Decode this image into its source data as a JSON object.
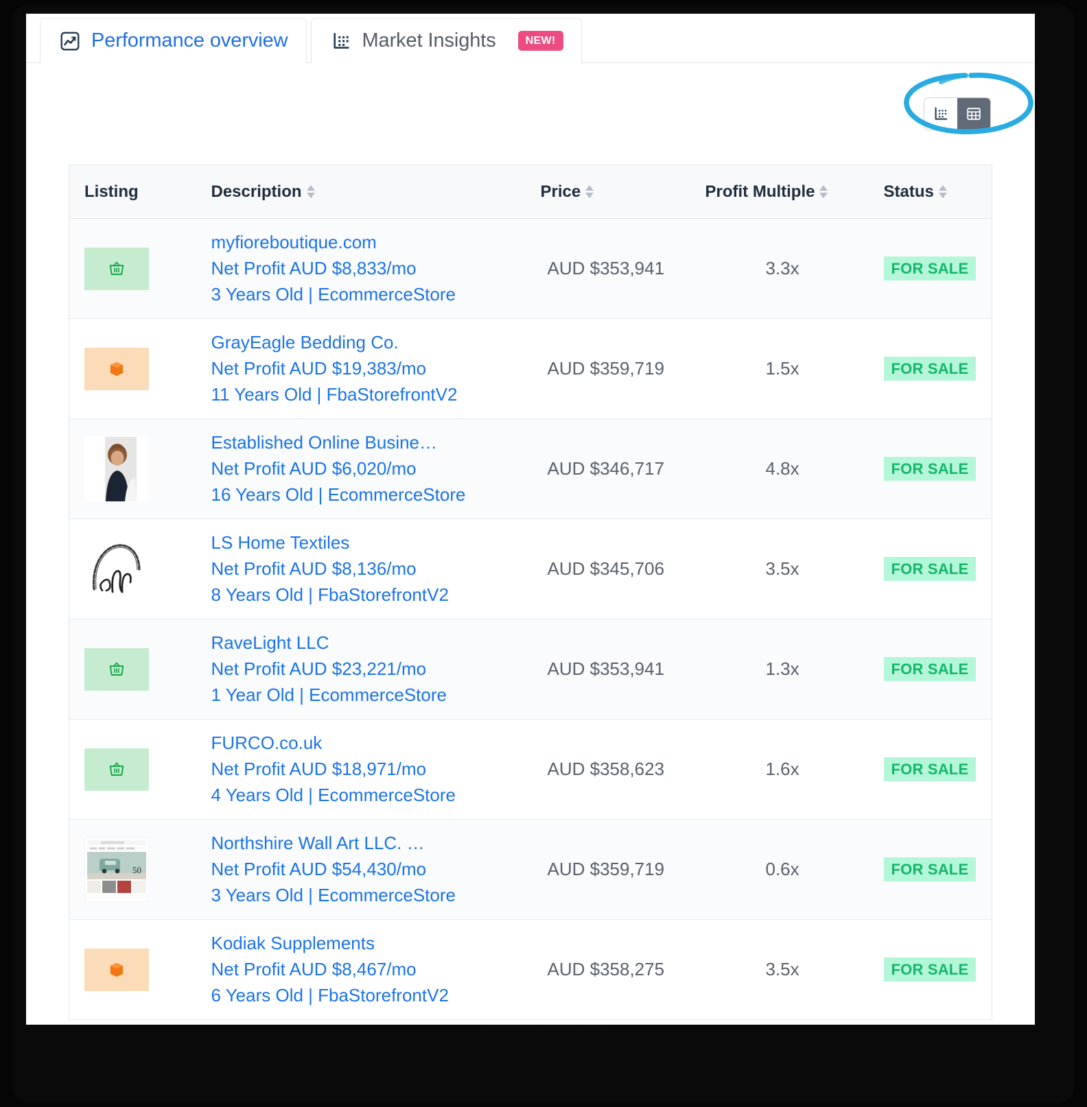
{
  "tabs": [
    {
      "label": "Performance overview",
      "icon": "trend-chart-icon",
      "active": false,
      "badge": null
    },
    {
      "label": "Market Insights",
      "icon": "scatter-plot-icon",
      "active": true,
      "badge": "NEW!"
    }
  ],
  "toolbar": {
    "view_toggle": {
      "chart_view_label": "Chart view",
      "table_view_label": "Table view",
      "selected": "table"
    },
    "annotation_color": "#29ABE2"
  },
  "table": {
    "columns": [
      {
        "label": "Listing",
        "sortable": false
      },
      {
        "label": "Description",
        "sortable": true
      },
      {
        "label": "Price",
        "sortable": true
      },
      {
        "label": "Profit Multiple",
        "sortable": true
      },
      {
        "label": "Status",
        "sortable": true
      }
    ],
    "rows": [
      {
        "thumb": "basket-icon-green",
        "title": "myfioreboutique.com",
        "net_profit": "Net Profit AUD $8,833/mo",
        "meta": "3 Years Old | EcommerceStore",
        "price": "AUD $353,941",
        "multiple": "3.3x",
        "status": "FOR SALE"
      },
      {
        "thumb": "package-icon-orange",
        "title": "GrayEagle Bedding Co.",
        "net_profit": "Net Profit AUD $19,383/mo",
        "meta": "11 Years Old | FbaStorefrontV2",
        "price": "AUD $359,719",
        "multiple": "1.5x",
        "status": "FOR SALE"
      },
      {
        "thumb": "photo-thumbnail",
        "title": "Established Online Busine…",
        "net_profit": "Net Profit AUD $6,020/mo",
        "meta": "16 Years Old | EcommerceStore",
        "price": "AUD $346,717",
        "multiple": "4.8x",
        "status": "FOR SALE"
      },
      {
        "thumb": "monogram-logo",
        "title": "LS Home Textiles",
        "net_profit": "Net Profit AUD $8,136/mo",
        "meta": "8 Years Old | FbaStorefrontV2",
        "price": "AUD $345,706",
        "multiple": "3.5x",
        "status": "FOR SALE"
      },
      {
        "thumb": "basket-icon-green",
        "title": "RaveLight LLC",
        "net_profit": "Net Profit AUD $23,221/mo",
        "meta": "1 Year Old | EcommerceStore",
        "price": "AUD $353,941",
        "multiple": "1.3x",
        "status": "FOR SALE"
      },
      {
        "thumb": "basket-icon-green",
        "title": "FURCO.co.uk",
        "net_profit": "Net Profit AUD $18,971/mo",
        "meta": "4 Years Old | EcommerceStore",
        "price": "AUD $358,623",
        "multiple": "1.6x",
        "status": "FOR SALE"
      },
      {
        "thumb": "website-screenshot",
        "title": "Northshire Wall Art LLC. …",
        "net_profit": "Net Profit AUD $54,430/mo",
        "meta": "3 Years Old | EcommerceStore",
        "price": "AUD $359,719",
        "multiple": "0.6x",
        "status": "FOR SALE"
      },
      {
        "thumb": "package-icon-orange",
        "title": "Kodiak Supplements",
        "net_profit": "Net Profit AUD $8,467/mo",
        "meta": "6 Years Old | FbaStorefrontV2",
        "price": "AUD $358,275",
        "multiple": "3.5x",
        "status": "FOR SALE"
      }
    ]
  },
  "colors": {
    "link": "#1a73e8",
    "status_badge_bg": "#b4f7d8",
    "status_badge_text": "#12b76a",
    "new_badge": "#ec4c82",
    "annotation": "#29abe2",
    "toggle_selected": "#616a78"
  }
}
